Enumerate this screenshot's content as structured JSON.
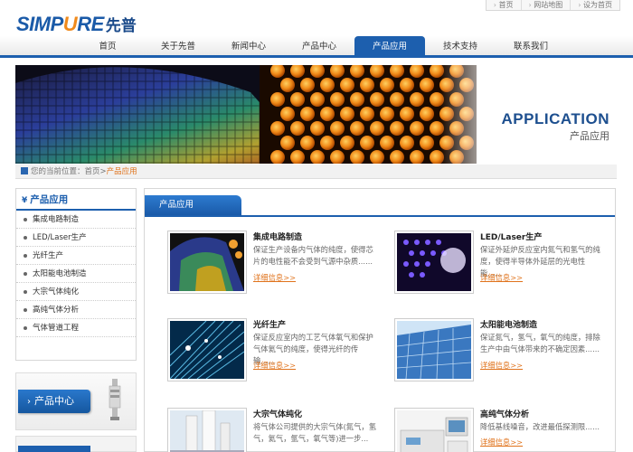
{
  "top_links": [
    "首页",
    "网站地图",
    "设为首页"
  ],
  "logo": {
    "en_a": "SIMP",
    "en_b": "U",
    "en_c": "RE",
    "cn": "先普"
  },
  "nav": [
    "首页",
    "关于先普",
    "新闻中心",
    "产品中心",
    "产品应用",
    "技术支持",
    "联系我们"
  ],
  "nav_active": "产品应用",
  "banner": {
    "title_en": "APPLICATION",
    "title_cn": "产品应用"
  },
  "breadcrumb": {
    "prefix": "您的当前位置：首页>",
    "current": "产品应用"
  },
  "sidebar": {
    "title": "产品应用",
    "items": [
      "集成电路制造",
      "LED/Laser生产",
      "光纤生产",
      "太阳能电池制造",
      "大宗气体纯化",
      "高纯气体分析",
      "气体管道工程"
    ]
  },
  "promo": {
    "label": "产品中心"
  },
  "main": {
    "tab": "产品应用",
    "more_label": "详细信息>>",
    "items": [
      {
        "title": "集成电路制造",
        "desc": "保证生产设备内气体的纯度，使得芯片的电性能不会受到气源中杂质......"
      },
      {
        "title": "LED/Laser生产",
        "desc": "保证外延炉反应室内氮气和氢气的纯度，使得半导体外延层的光电性能......"
      },
      {
        "title": "光纤生产",
        "desc": "保证反应室内的工艺气体氧气和保护气体氦气的纯度，使得光纤的传输......"
      },
      {
        "title": "太阳能电池制造",
        "desc": "保证氮气，氢气，氧气的纯度，排除生产中由气体带来的不确定因素......"
      },
      {
        "title": "大宗气体纯化",
        "desc": "将气体公司提供的大宗气体(氮气，氢气，氦气，氩气，氧气等)进一步..."
      },
      {
        "title": "高纯气体分析",
        "desc": "降低基线噪音，改进最低探测限......"
      }
    ]
  },
  "icons": {
    "nav_arrow": "chevron-right-icon",
    "home": "home-icon"
  }
}
